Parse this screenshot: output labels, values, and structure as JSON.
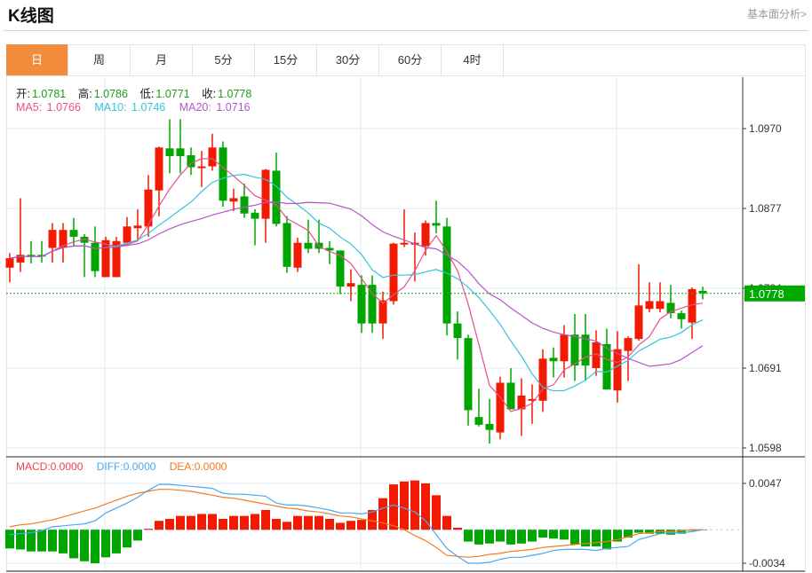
{
  "header": {
    "title": "K线图",
    "link": "基本面分析>"
  },
  "tabs": [
    {
      "label": "日",
      "active": true
    },
    {
      "label": "周"
    },
    {
      "label": "月"
    },
    {
      "label": "5分"
    },
    {
      "label": "15分"
    },
    {
      "label": "30分"
    },
    {
      "label": "60分"
    },
    {
      "label": "4时"
    }
  ],
  "ohlc_info": {
    "open_label": "开:",
    "open": "1.0781",
    "high_label": "高:",
    "high": "1.0786",
    "low_label": "低:",
    "low": "1.0771",
    "close_label": "收:",
    "close": "1.0778"
  },
  "ma_info": {
    "ma5_label": "MA5:",
    "ma5": "1.0766",
    "ma10_label": "MA10:",
    "ma10": "1.0746",
    "ma20_label": "MA20:",
    "ma20": "1.0716"
  },
  "macd_info": {
    "macd_label": "MACD:",
    "macd": "0.0000",
    "diff_label": "DIFF:",
    "diff": "0.0000",
    "dea_label": "DEA:",
    "dea": "0.0000"
  },
  "colors": {
    "up": "#f21a00",
    "down": "#00a600",
    "ma5": "#e8508a",
    "ma10": "#35c4dc",
    "ma20": "#b455c8",
    "diff": "#4aa8f0",
    "dea": "#f57a20",
    "active_tab": "#f28c3c"
  },
  "chart_data": [
    {
      "type": "candlestick",
      "title": "K线图",
      "ylim": [
        1.0598,
        1.097
      ],
      "y_ticks": [
        "1.0970",
        "1.0877",
        "1.0784",
        "1.0691",
        "1.0598"
      ],
      "current_price": "1.0778",
      "ma_periods": [
        5,
        10,
        20
      ],
      "ohlc": [
        [
          1.0808,
          1.0825,
          1.0791,
          1.0819
        ],
        [
          1.0814,
          1.0889,
          1.0803,
          1.0823
        ],
        [
          1.0823,
          1.0839,
          1.0813,
          1.0821
        ],
        [
          1.0823,
          1.0839,
          1.0814,
          1.0821
        ],
        [
          1.0831,
          1.086,
          1.0814,
          1.0852
        ],
        [
          1.0831,
          1.086,
          1.0814,
          1.0852
        ],
        [
          1.0852,
          1.0866,
          1.0833,
          1.0844
        ],
        [
          1.0844,
          1.0847,
          1.0797,
          1.0837
        ],
        [
          1.0837,
          1.0856,
          1.0797,
          1.0804
        ],
        [
          1.0797,
          1.0844,
          1.0797,
          1.084
        ],
        [
          1.0797,
          1.0844,
          1.0797,
          1.0839
        ],
        [
          1.0837,
          1.0867,
          1.0837,
          1.0856
        ],
        [
          1.0854,
          1.0876,
          1.0841,
          1.0857
        ],
        [
          1.0856,
          1.0916,
          1.0844,
          1.0899
        ],
        [
          1.0898,
          1.0949,
          1.0868,
          1.0948
        ],
        [
          1.0947,
          1.0981,
          1.0918,
          1.0938
        ],
        [
          1.0947,
          1.0981,
          1.0918,
          1.0938
        ],
        [
          1.0939,
          1.0948,
          1.0916,
          1.0925
        ],
        [
          1.0924,
          1.0944,
          1.0902,
          1.0926
        ],
        [
          1.0926,
          1.0964,
          1.0921,
          1.0948
        ],
        [
          1.0948,
          1.0955,
          1.0879,
          1.0886
        ],
        [
          1.0885,
          1.09,
          1.0874,
          1.0889
        ],
        [
          1.0891,
          1.0906,
          1.0866,
          1.0871
        ],
        [
          1.0872,
          1.0876,
          1.0834,
          1.0865
        ],
        [
          1.0865,
          1.0923,
          1.0837,
          1.0922
        ],
        [
          1.0921,
          1.0942,
          1.0856,
          1.0859
        ],
        [
          1.086,
          1.0868,
          1.0802,
          1.0809
        ],
        [
          1.0808,
          1.0843,
          1.0803,
          1.0837
        ],
        [
          1.0837,
          1.0864,
          1.0825,
          1.083
        ],
        [
          1.0837,
          1.0864,
          1.0825,
          1.083
        ],
        [
          1.0831,
          1.0839,
          1.0812,
          1.0828
        ],
        [
          1.0828,
          1.0828,
          1.0777,
          1.0786
        ],
        [
          1.0786,
          1.0806,
          1.0769,
          1.079
        ],
        [
          1.0788,
          1.0799,
          1.0732,
          1.0743
        ],
        [
          1.0788,
          1.0799,
          1.0732,
          1.0743
        ],
        [
          1.0743,
          1.078,
          1.0725,
          1.077
        ],
        [
          1.0769,
          1.0837,
          1.0765,
          1.0836
        ],
        [
          1.0835,
          1.0876,
          1.0832,
          1.0837
        ],
        [
          1.0835,
          1.0849,
          1.0792,
          1.0837
        ],
        [
          1.0833,
          1.0863,
          1.0822,
          1.086
        ],
        [
          1.086,
          1.0886,
          1.0848,
          1.0857
        ],
        [
          1.0856,
          1.0866,
          1.0729,
          1.0743
        ],
        [
          1.0743,
          1.0757,
          1.0701,
          1.0726
        ],
        [
          1.0726,
          1.073,
          1.0624,
          1.0642
        ],
        [
          1.0634,
          1.0667,
          1.0623,
          1.0625
        ],
        [
          1.0626,
          1.0655,
          1.0603,
          1.0619
        ],
        [
          1.0616,
          1.0681,
          1.0608,
          1.0674
        ],
        [
          1.0674,
          1.0691,
          1.0643,
          1.0643
        ],
        [
          1.0643,
          1.0679,
          1.0612,
          1.0659
        ],
        [
          1.0653,
          1.0672,
          1.0626,
          1.0655
        ],
        [
          1.0653,
          1.0713,
          1.064,
          1.0702
        ],
        [
          1.0703,
          1.0715,
          1.068,
          1.0699
        ],
        [
          1.0699,
          1.0741,
          1.068,
          1.073
        ],
        [
          1.073,
          1.0754,
          1.0676,
          1.0694
        ],
        [
          1.073,
          1.0754,
          1.0676,
          1.0694
        ],
        [
          1.0691,
          1.0735,
          1.0682,
          1.0721
        ],
        [
          1.0719,
          1.0737,
          1.0666,
          1.0666
        ],
        [
          1.0665,
          1.0734,
          1.0651,
          1.0713
        ],
        [
          1.0711,
          1.0728,
          1.0676,
          1.0726
        ],
        [
          1.0725,
          1.0812,
          1.0723,
          1.0764
        ],
        [
          1.076,
          1.0791,
          1.0756,
          1.0769
        ],
        [
          1.076,
          1.0791,
          1.0756,
          1.0769
        ],
        [
          1.0767,
          1.0788,
          1.0749,
          1.0755
        ],
        [
          1.0755,
          1.0758,
          1.0737,
          1.0748
        ],
        [
          1.0744,
          1.0785,
          1.0725,
          1.0783
        ],
        [
          1.0781,
          1.0786,
          1.0771,
          1.0778
        ]
      ]
    },
    {
      "type": "bar+line",
      "title": "MACD",
      "ylim": [
        -0.0034,
        0.0047
      ],
      "y_ticks": [
        "0.0047",
        "-0.0034"
      ],
      "macd": [
        -0.0019,
        -0.002,
        -0.0022,
        -0.0022,
        -0.0022,
        -0.0024,
        -0.0029,
        -0.0032,
        -0.0034,
        -0.0028,
        -0.0024,
        -0.0018,
        -0.0011,
        0.0001,
        0.0009,
        0.0011,
        0.0014,
        0.0014,
        0.0016,
        0.0016,
        0.0011,
        0.0014,
        0.0014,
        0.0016,
        0.002,
        0.0011,
        0.0008,
        0.0014,
        0.0014,
        0.0014,
        0.0011,
        0.0007,
        0.0009,
        0.001,
        0.002,
        0.0032,
        0.0046,
        0.0049,
        0.005,
        0.0047,
        0.0035,
        0.0014,
        0.0002,
        -0.0012,
        -0.0015,
        -0.0014,
        -0.0012,
        -0.0015,
        -0.0014,
        -0.0012,
        -0.0008,
        -0.0009,
        -0.001,
        -0.0015,
        -0.0017,
        -0.0017,
        -0.002,
        -0.0012,
        -0.0008,
        -0.0003,
        -0.0004,
        -0.0004,
        -0.0005,
        -0.0004,
        -0.0001,
        0.0
      ],
      "diff": [
        -0.0005,
        -0.0004,
        -0.0003,
        -0.0001,
        0.0003,
        0.0004,
        0.0005,
        0.0006,
        0.0009,
        0.0017,
        0.0022,
        0.0027,
        0.0033,
        0.004,
        0.0046,
        0.0046,
        0.0045,
        0.0044,
        0.0043,
        0.0042,
        0.0037,
        0.0036,
        0.0036,
        0.0035,
        0.0034,
        0.0027,
        0.0025,
        0.0025,
        0.0024,
        0.0022,
        0.002,
        0.0017,
        0.0017,
        0.0016,
        0.0018,
        0.0022,
        0.0025,
        0.0022,
        0.0018,
        0.0009,
        -0.0005,
        -0.0019,
        -0.0027,
        -0.0034,
        -0.0034,
        -0.0033,
        -0.003,
        -0.0028,
        -0.0028,
        -0.0026,
        -0.0024,
        -0.0021,
        -0.002,
        -0.002,
        -0.002,
        -0.0021,
        -0.0019,
        -0.0018,
        -0.0017,
        -0.001,
        -0.0007,
        -0.0004,
        -0.0003,
        -0.0003,
        -0.0002,
        0.0
      ],
      "dea": [
        0.0003,
        0.0005,
        0.0006,
        0.0008,
        0.001,
        0.0013,
        0.0016,
        0.0019,
        0.0022,
        0.0026,
        0.003,
        0.0034,
        0.0037,
        0.0039,
        0.0041,
        0.0041,
        0.004,
        0.0039,
        0.0037,
        0.0035,
        0.0033,
        0.0032,
        0.003,
        0.0028,
        0.0026,
        0.0024,
        0.0022,
        0.0021,
        0.0019,
        0.0018,
        0.0016,
        0.0014,
        0.0013,
        0.0011,
        0.0009,
        0.0007,
        0.0004,
        0.0,
        -0.0006,
        -0.0011,
        -0.0018,
        -0.0026,
        -0.0027,
        -0.0028,
        -0.0027,
        -0.0025,
        -0.0024,
        -0.0022,
        -0.0021,
        -0.002,
        -0.0018,
        -0.0017,
        -0.0016,
        -0.0015,
        -0.0014,
        -0.0013,
        -0.0012,
        -0.001,
        -0.0007,
        -0.0004,
        -0.0003,
        -0.0002,
        -0.0002,
        -0.0001,
        0.0,
        0.0
      ]
    }
  ]
}
